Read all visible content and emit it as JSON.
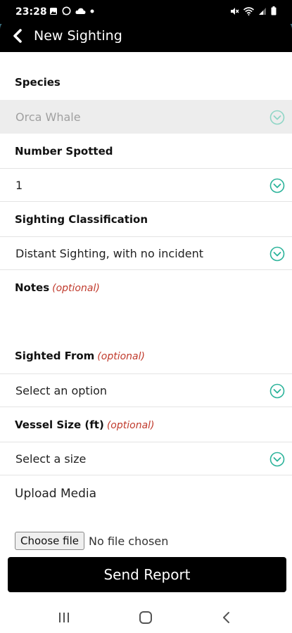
{
  "status_bar": {
    "time": "23:28",
    "left_icons": [
      "image-icon",
      "whatsapp-icon",
      "cloud-icon",
      "dot-icon"
    ],
    "right_icons": [
      "mute-icon",
      "wifi-icon",
      "signal-icon",
      "battery-icon"
    ]
  },
  "header": {
    "title": "New Sighting",
    "back_icon": "chevron-left-icon"
  },
  "form": {
    "species": {
      "label": "Species",
      "value": "Orca Whale",
      "disabled": true
    },
    "number_spotted": {
      "label": "Number Spotted",
      "value": "1"
    },
    "classification": {
      "label": "Sighting Classification",
      "value": "Distant Sighting, with no incident"
    },
    "notes": {
      "label": "Notes",
      "optional": "(optional)"
    },
    "sighted_from": {
      "label": "Sighted From",
      "optional": "(optional)",
      "placeholder": "Select an option"
    },
    "vessel_size": {
      "label": "Vessel Size (ft)",
      "optional": "(optional)",
      "placeholder": "Select a size"
    },
    "upload": {
      "label": "Upload Media",
      "button": "Choose file",
      "status": "No file chosen"
    }
  },
  "submit_label": "Send Report",
  "nav": [
    "recents-icon",
    "home-icon",
    "back-icon"
  ],
  "colors": {
    "accent": "#2bb39a",
    "optional": "#c0392b",
    "header": "#000000"
  }
}
